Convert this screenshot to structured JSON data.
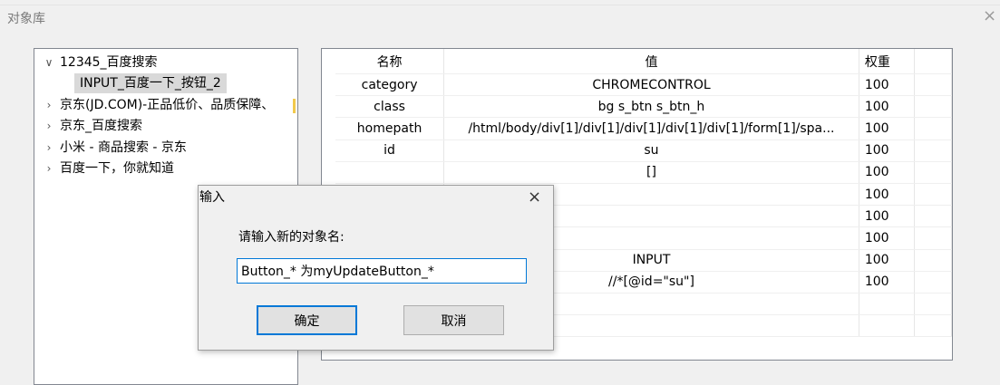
{
  "window": {
    "title": "对象库",
    "close_glyph": "×"
  },
  "tree": {
    "root": {
      "toggle": "∨",
      "label": "12345_百度搜索"
    },
    "selected_child": {
      "label": "INPUT_百度一下_按钮_2"
    },
    "nodes": [
      {
        "toggle": "›",
        "label": "京东(JD.COM)-正品低价、品质保障、"
      },
      {
        "toggle": "›",
        "label": "京东_百度搜索"
      },
      {
        "toggle": "›",
        "label": "小米 - 商品搜索 - 京东"
      },
      {
        "toggle": "›",
        "label": "百度一下，你就知道"
      }
    ]
  },
  "table": {
    "headers": {
      "name": "名称",
      "value": "值",
      "weight": "权重"
    },
    "rows": [
      {
        "name": "category",
        "value": "CHROMECONTROL",
        "weight": "100"
      },
      {
        "name": "class",
        "value": "bg s_btn s_btn_h",
        "weight": "100"
      },
      {
        "name": "homepath",
        "value": "/html/body/div[1]/div[1]/div[1]/div[1]/div[1]/form[1]/spa...",
        "weight": "100"
      },
      {
        "name": "id",
        "value": "su",
        "weight": "100"
      },
      {
        "name": "",
        "value": "[]",
        "weight": "100"
      },
      {
        "name": "",
        "value": "",
        "weight": "100"
      },
      {
        "name": "",
        "value": "",
        "weight": "100"
      },
      {
        "name": "",
        "value": "",
        "weight": "100"
      },
      {
        "name": "",
        "value": "INPUT",
        "weight": "100"
      },
      {
        "name": "",
        "value": "//*[@id=\"su\"]",
        "weight": "100"
      },
      {
        "name": "",
        "value": "",
        "weight": ""
      },
      {
        "name": "",
        "value": "",
        "weight": ""
      }
    ]
  },
  "dialog": {
    "title": "输入",
    "close_glyph": "×",
    "prompt": "请输入新的对象名:",
    "input_value": "Button_* 为myUpdateButton_*",
    "ok_label": "确定",
    "cancel_label": "取消"
  }
}
